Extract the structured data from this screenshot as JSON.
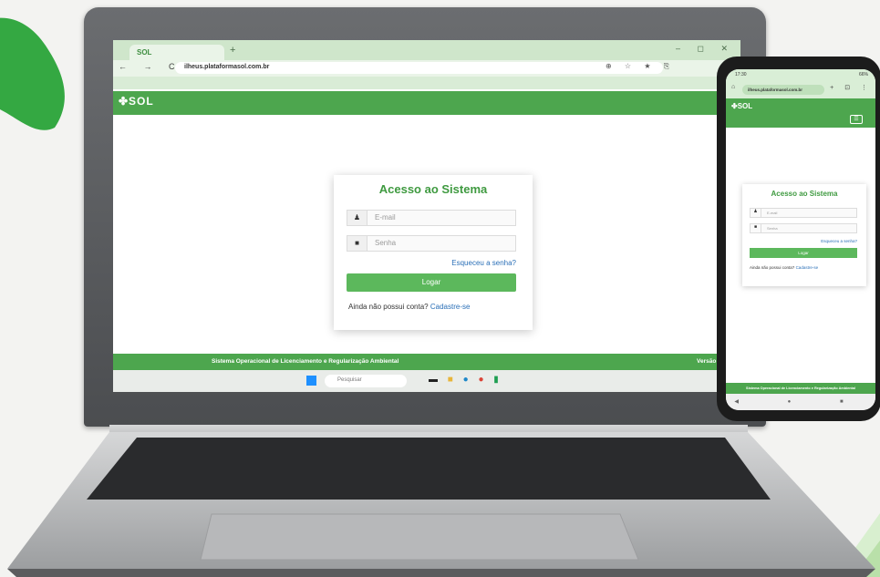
{
  "laptop": {
    "browser": {
      "tab_label": "SOL",
      "url": "ilheus.plataformasol.com.br",
      "nav_icons": "← → C ⌂",
      "url_icons": "⊕ ☆ ★ ⎘",
      "window_controls": "– ◻ ✕",
      "new_tab_icon": "+"
    },
    "site": {
      "logo": "✤SOL",
      "login": {
        "title": "Acesso ao Sistema",
        "email_placeholder": "E-mail",
        "password_placeholder": "Senha",
        "forgot_link": "Esqueceu a senha?",
        "login_button": "Logar",
        "no_account_text": "Ainda não possui conta?",
        "signup_link": "Cadastre-se"
      },
      "footer": {
        "text": "Sistema Operacional de Licenciamento e Regularização Ambiental",
        "version": "Versão"
      }
    },
    "taskbar": {
      "search_placeholder": "Pesquisar",
      "apps": [
        "terminal",
        "file-explorer",
        "edge",
        "chrome",
        "sheets"
      ]
    }
  },
  "phone": {
    "status_time": "17:30",
    "status_battery": "66%",
    "url": "ilheus.plataformasol.com.br",
    "url_icons": "+ ⊡ ⋮",
    "logo": "✤SOL",
    "menu_icon": "☰",
    "login": {
      "title": "Acesso ao Sistema",
      "email_placeholder": "E-mail",
      "password_placeholder": "Senha",
      "forgot_link": "Esqueceu a senha?",
      "login_button": "Logar",
      "no_account_text": "Ainda não possui conta?",
      "signup_link": "Cadastre-se"
    },
    "footer_text": "Sistema Operacional de Licenciamento e Regularização Ambiental",
    "nav_buttons": "◀ ● ■"
  },
  "colors": {
    "brand_green": "#4da64e",
    "title_green": "#3f9a40",
    "button_green": "#5cb85c",
    "link_blue": "#2a6fb7",
    "chrome_green": "#cfe6cb",
    "background": "#f3f3f1"
  }
}
